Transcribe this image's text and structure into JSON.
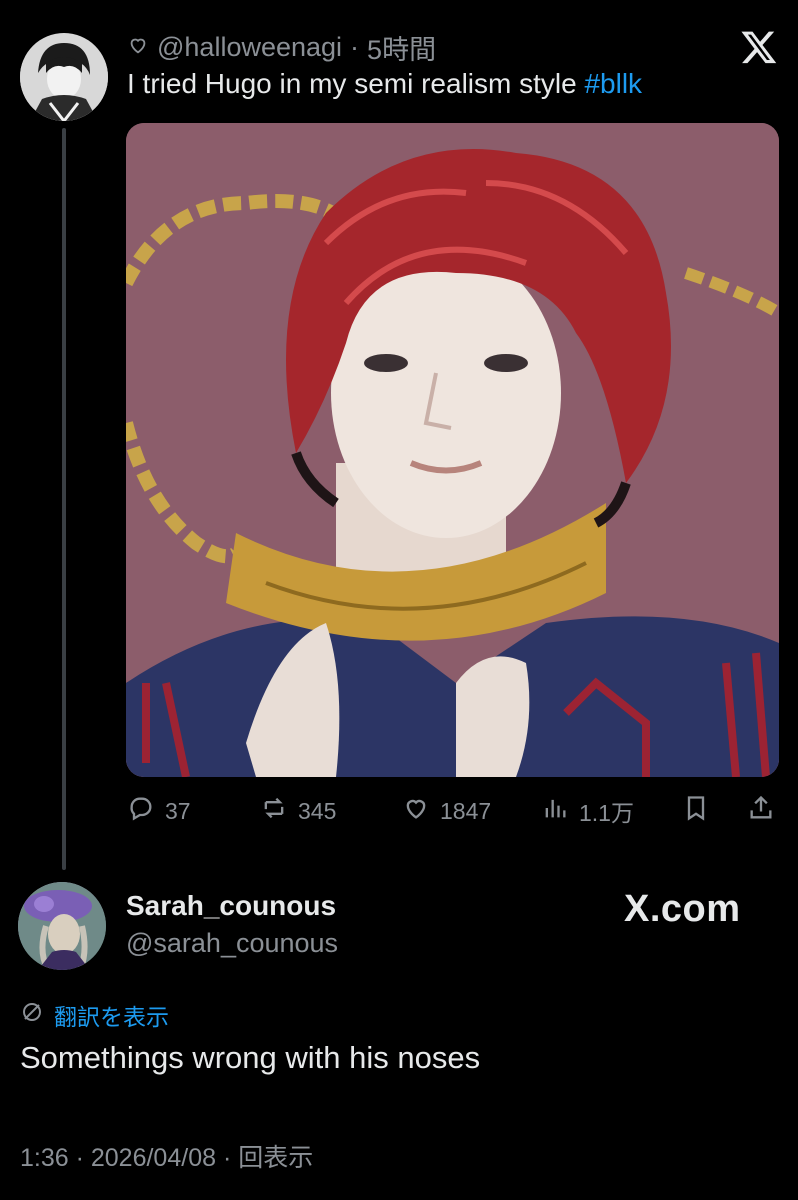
{
  "parent_tweet": {
    "handle": "@halloweenagi",
    "separator": "·",
    "time": "5時間",
    "text": "I tried Hugo in my semi realism style ",
    "hashtag": "#bllk",
    "stats": {
      "replies": "37",
      "reposts": "345",
      "likes": "1847",
      "views": "1.1万"
    }
  },
  "reply": {
    "display_name": "Sarah_counous",
    "handle": "@sarah_counous",
    "translate_label": "翻訳を表示",
    "text": "Somethings wrong with his noses",
    "footer": "1:36 · 2026/04/08 · 回表示"
  },
  "watermark": "X.com",
  "icons": [
    "heart-outline-icon",
    "x-logo-icon",
    "reply-icon",
    "repost-icon",
    "like-icon",
    "views-icon",
    "bookmark-icon",
    "share-icon",
    "translate-icon"
  ],
  "colors": {
    "background": "#000000",
    "accent": "#1d9bf0",
    "muted": "#8b9096",
    "text": "#e7e9ea"
  }
}
